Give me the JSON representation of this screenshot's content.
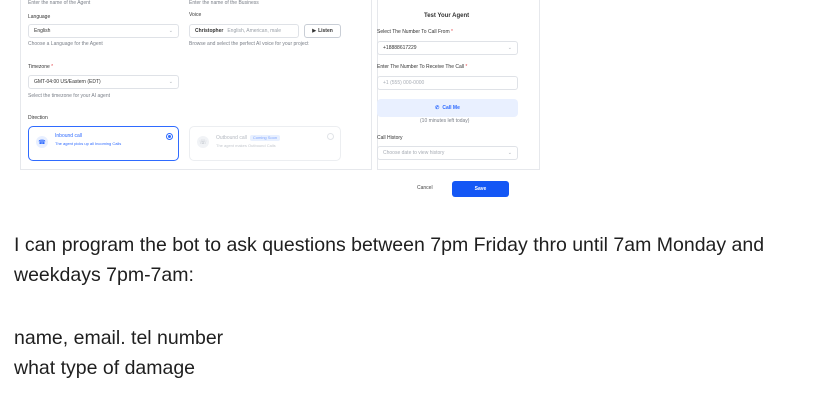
{
  "form": {
    "agent_name_hint": "Enter the name of the Agent",
    "business_name_hint": "Enter the name of the Business",
    "language": {
      "label": "Language",
      "value": "English",
      "hint": "Choose a Language for the Agent"
    },
    "voice": {
      "label": "Voice",
      "name": "Christopher",
      "description": "English, American, male",
      "listen_label": "Listen",
      "hint": "Browse and select the perfect AI voice for your project"
    },
    "timezone": {
      "label": "Timezone",
      "required_mark": "*",
      "value": "GMT-04:00 US/Eastern (EDT)",
      "hint": "Select the timezone for your AI agent"
    },
    "direction": {
      "label": "Direction",
      "options": [
        {
          "title": "Inbound call",
          "subtitle": "The agent picks up all Incoming Calls",
          "selected": true
        },
        {
          "title": "Outbound call",
          "badge": "Coming Soon",
          "subtitle": "The agent makes Outbound Calls",
          "selected": false
        }
      ]
    }
  },
  "test_panel": {
    "title": "Test Your Agent",
    "from": {
      "label": "Select The Number To Call From",
      "required_mark": "*",
      "value": "+18888617229"
    },
    "to": {
      "label": "Enter The Number To Receive The Call",
      "required_mark": "*",
      "placeholder": "+1 (555) 000-0000"
    },
    "call_button": "Call Me",
    "minutes_left": "(10 minutes left today)",
    "history": {
      "label": "Call History",
      "placeholder": "Choose date to view history"
    }
  },
  "footer": {
    "cancel_label": "Cancel",
    "save_label": "Save"
  },
  "message": {
    "line1": "I can program the bot to ask questions between 7pm Friday thro until 7am Monday and",
    "line2": "weekdays 7pm-7am:",
    "line3": "name, email. tel number",
    "line4": "what type of damage"
  },
  "colors": {
    "primary": "#1457f5",
    "accent": "#2f6bff",
    "required": "#e5484d"
  },
  "icons": [
    "chevron-down-icon",
    "play-icon",
    "phone-icon",
    "inbound-call-icon",
    "outbound-call-icon"
  ]
}
